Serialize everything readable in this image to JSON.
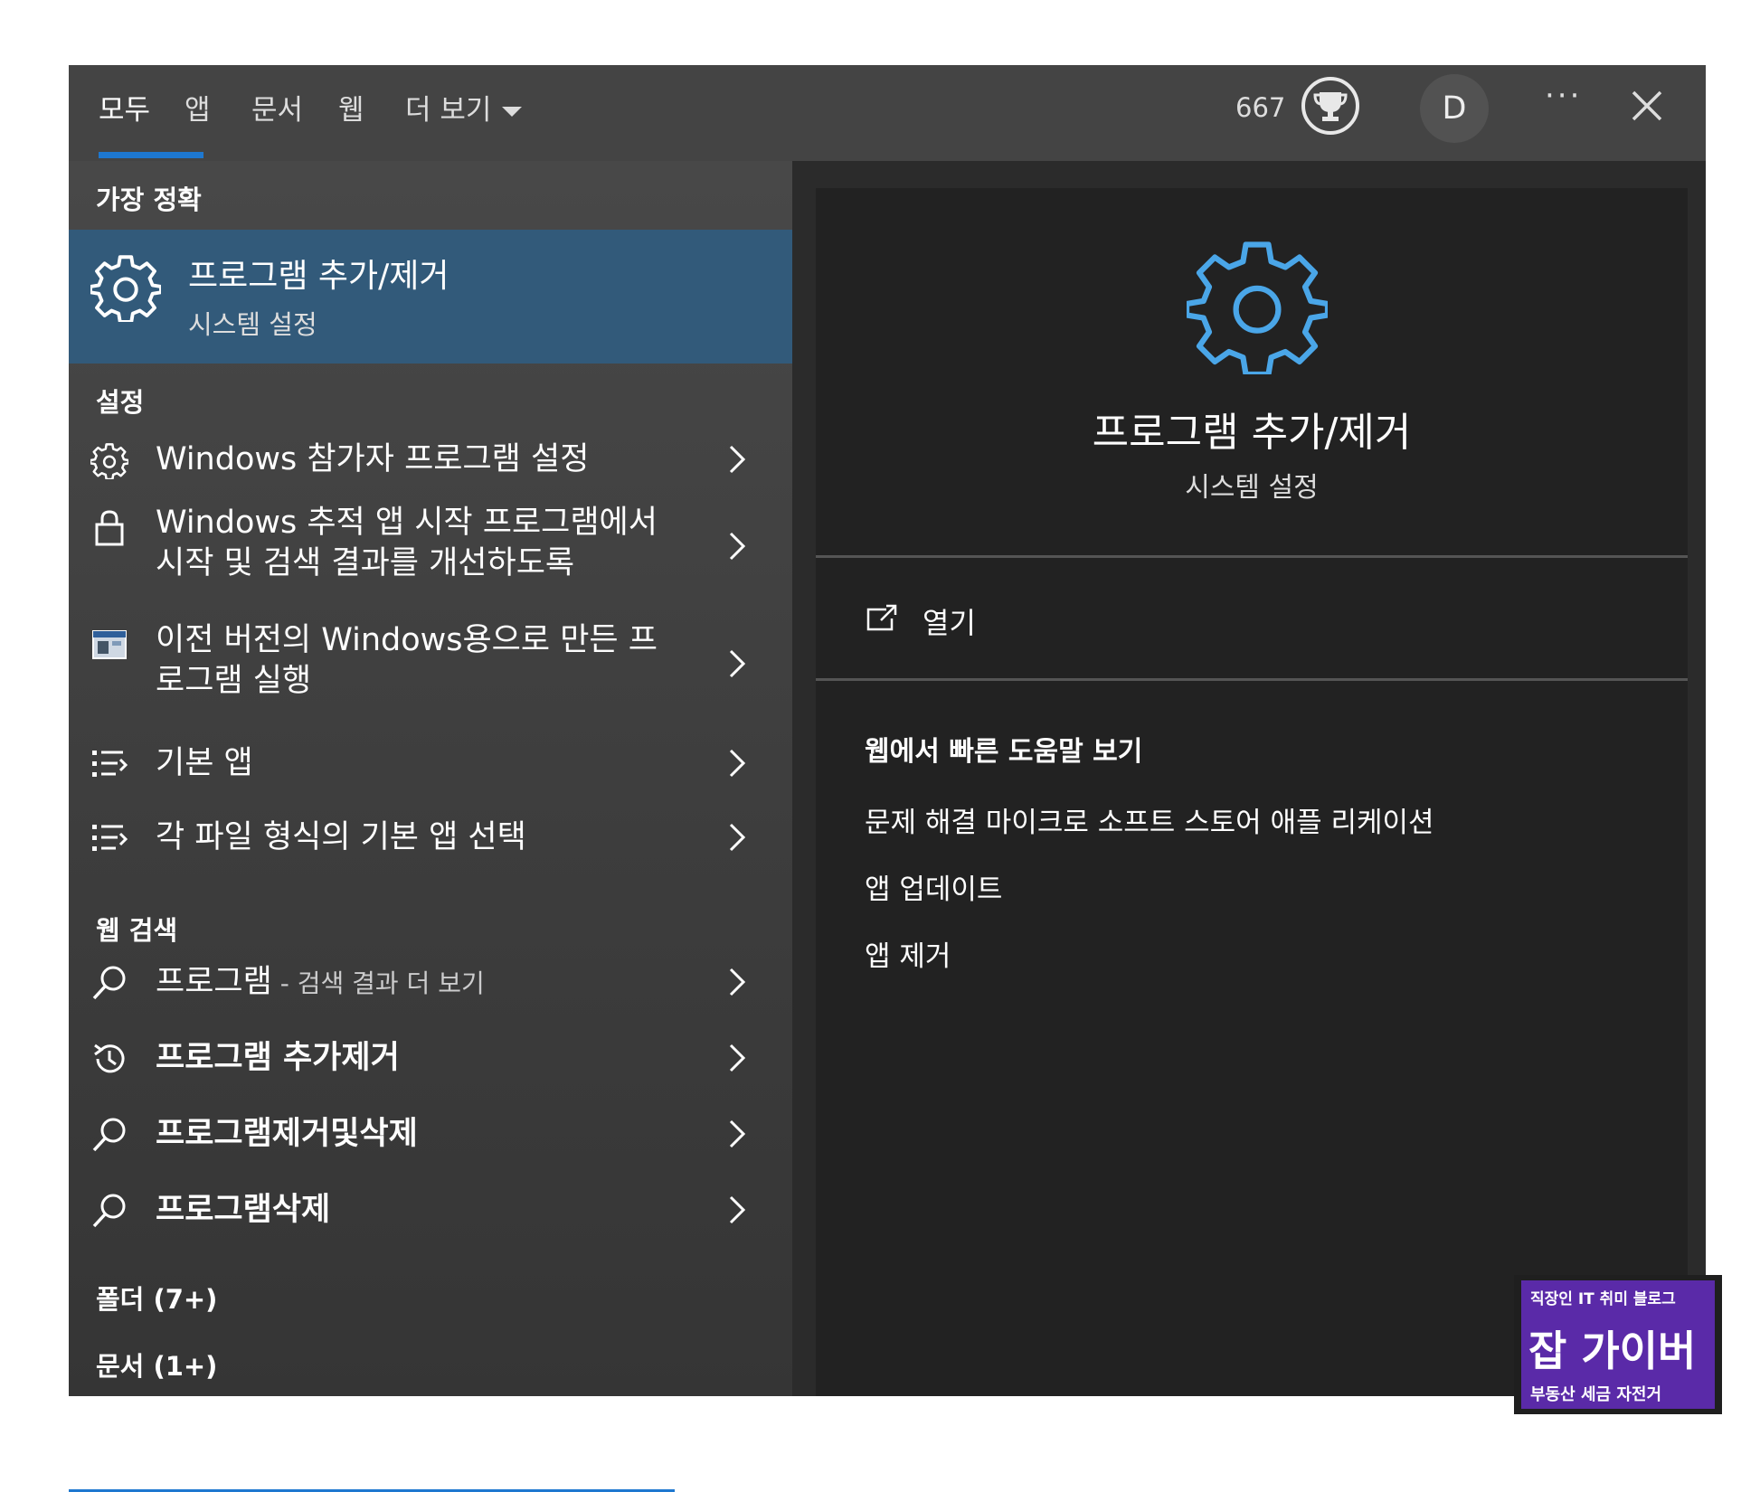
{
  "header": {
    "tabs": [
      {
        "label": "모두",
        "active": true
      },
      {
        "label": "앱"
      },
      {
        "label": "문서"
      },
      {
        "label": "웹"
      },
      {
        "label": "더 보기"
      }
    ],
    "points": "667",
    "avatar_initial": "D",
    "more_label": "···"
  },
  "best_match": {
    "section_label": "가장 정확",
    "title": "프로그램 추가/제거",
    "subtitle": "시스템 설정",
    "icon": "gear-icon"
  },
  "settings_section": {
    "section_label": "설정",
    "items": [
      {
        "label": "Windows 참가자 프로그램 설정",
        "icon": "gear-icon"
      },
      {
        "label": "Windows 추적 앱 시작 프로그램에서 시작 및 검색 결과를 개선하도록",
        "icon": "lock-icon"
      },
      {
        "label": "이전 버전의 Windows용으로 만든 프로그램 실행",
        "icon": "window-app-icon"
      },
      {
        "label": "기본 앱",
        "icon": "list-icon"
      },
      {
        "label": "각 파일 형식의 기본 앱 선택",
        "icon": "list-icon"
      }
    ]
  },
  "web_section": {
    "section_label": "웹 검색",
    "items": [
      {
        "label": "프로그램",
        "suffix": " - 검색 결과 더 보기",
        "icon": "search-icon"
      },
      {
        "label": "프로그램 추가제거",
        "icon": "history-icon"
      },
      {
        "label": "프로그램제거및삭제",
        "icon": "search-icon"
      },
      {
        "label": "프로그램삭제",
        "icon": "search-icon"
      }
    ]
  },
  "folders_label": "폴더 (7+)",
  "documents_label": "문서 (1+)",
  "detail": {
    "title": "프로그램 추가/제거",
    "subtitle": "시스템 설정",
    "open_label": "열기",
    "web_help_title": "웹에서 빠른 도움말 보기",
    "links": [
      "문제 해결 마이크로 소프트 스토어 애플 리케이션",
      "앱 업데이트",
      "앱 제거"
    ]
  },
  "watermark": {
    "top": "직장인 IT 취미 블로그",
    "middle": "잡 가이버",
    "bottom": "부동산 세금 자전거"
  },
  "colors": {
    "accent": "#1e78d0",
    "selected_row": "#325a7a",
    "gear_blue": "#4aa6e8"
  }
}
